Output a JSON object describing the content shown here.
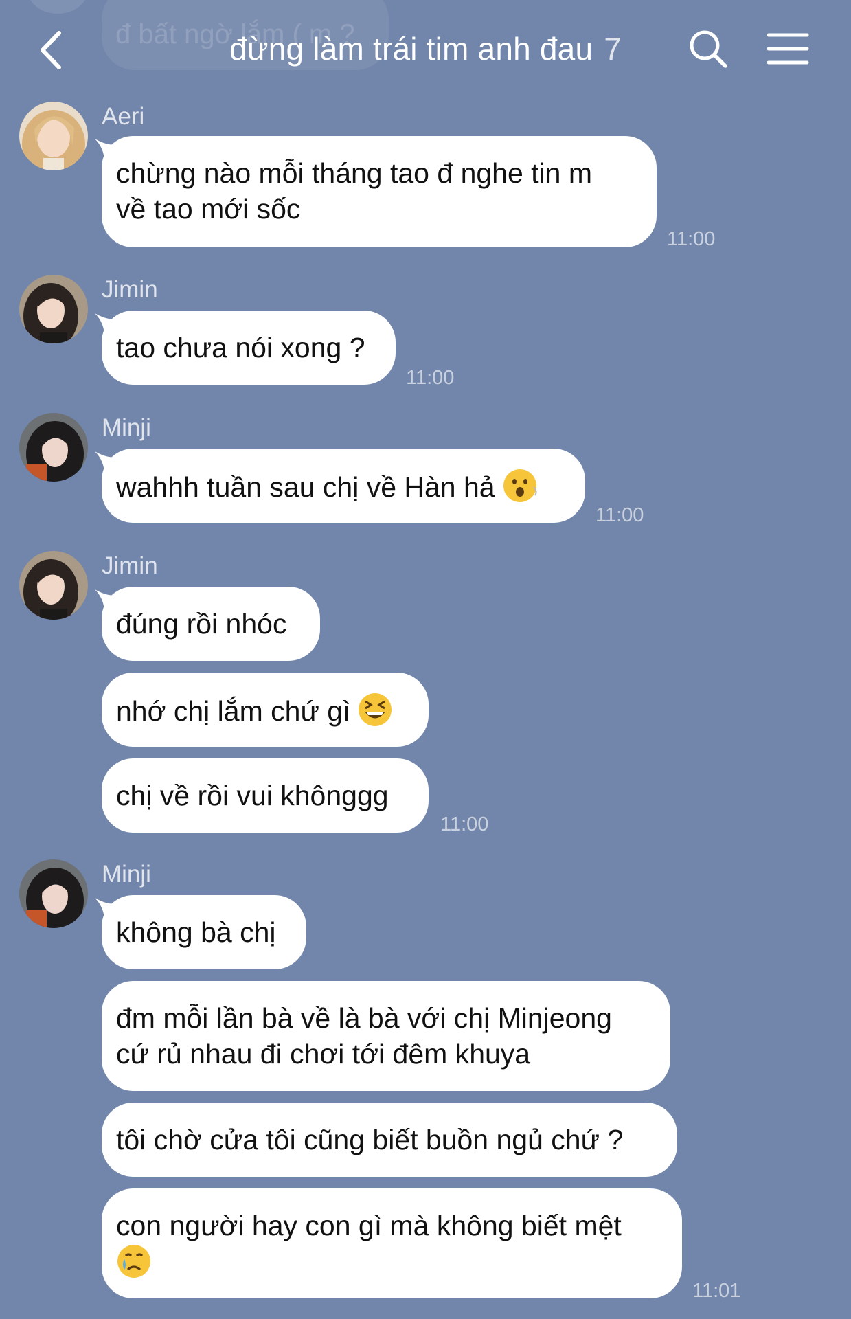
{
  "header": {
    "title": "đừng làm trái tim anh đau",
    "member_count": "7",
    "behind_message": "đ bất ngờ lắm ( m ?"
  },
  "messages": [
    {
      "sender": "Aeri",
      "lines": [
        "chừng nào mỗi tháng tao đ nghe tin m",
        "về tao mới sốc"
      ],
      "time": "11:00"
    },
    {
      "sender": "Jimin",
      "lines": [
        "tao chưa nói xong ?"
      ],
      "time": "11:00"
    },
    {
      "sender": "Minji",
      "lines": [
        "wahhh tuần sau chị về Hàn hả"
      ],
      "emoji": "hushed-face-emoji",
      "time": "11:00"
    },
    {
      "sender": "Jimin",
      "lines": [
        "đúng rồi nhóc"
      ]
    },
    {
      "lines": [
        "nhớ chị lắm chứ gì"
      ],
      "emoji": "grinning-squinting-face-emoji"
    },
    {
      "lines": [
        "chị về rồi vui khônggg"
      ],
      "time": "11:00"
    },
    {
      "sender": "Minji",
      "lines": [
        "không bà chị"
      ]
    },
    {
      "lines": [
        "đm mỗi lần bà về là bà với chị Minjeong",
        "cứ rủ nhau đi chơi tới đêm khuya"
      ]
    },
    {
      "lines": [
        "tôi chờ cửa tôi cũng biết buồn ngủ chứ ?"
      ]
    },
    {
      "lines": [
        "con người hay con gì mà không biết mệt"
      ],
      "emoji": "crying-face-emoji",
      "time": "11:01"
    }
  ],
  "colors": {
    "background": "#7286ab",
    "bubble": "#ffffff",
    "text": "#111111"
  }
}
